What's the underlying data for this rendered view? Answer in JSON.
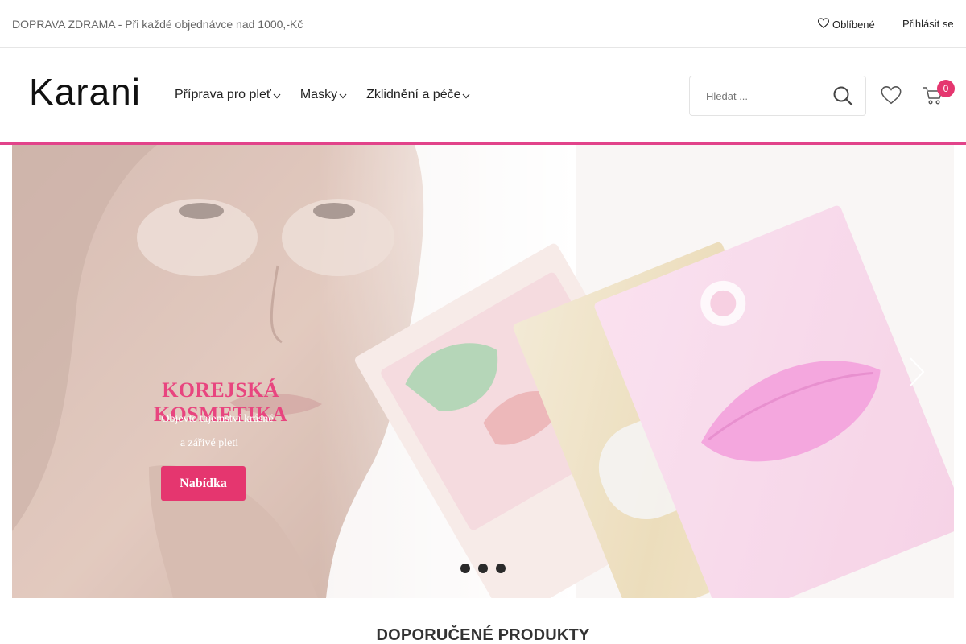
{
  "topbar": {
    "promo": "DOPRAVA ZDRAMA - Při každé objednávce nad 1000,-Kč",
    "favorites_label": "Oblíbené",
    "login_label": "Přihlásit se"
  },
  "header": {
    "logo": "Karani",
    "nav": [
      {
        "label": "Příprava pro pleť"
      },
      {
        "label": "Masky"
      },
      {
        "label": "Zklidnění a péče"
      }
    ],
    "search": {
      "placeholder": "Hledat ..."
    },
    "cart_count": "0"
  },
  "hero": {
    "title": "KOREJSKÁ KOSMETIKA",
    "subtitle_line1": "Objevte tajemství krásné",
    "subtitle_line2": "a zářivé pleti",
    "cta_label": "Nabídka",
    "slide_count": 3
  },
  "featured": {
    "title": "DOPORUČENÉ PRODUKTY"
  },
  "colors": {
    "accent": "#e5366f",
    "accent_line": "#e2438a",
    "hero_title": "#e8457f"
  },
  "icons": {
    "favorites": "heart-icon",
    "nav_dropdown": "chevron-down-icon",
    "search": "search-icon",
    "wishlist": "heart-icon",
    "cart": "cart-icon",
    "slider_next": "chevron-right-icon"
  }
}
